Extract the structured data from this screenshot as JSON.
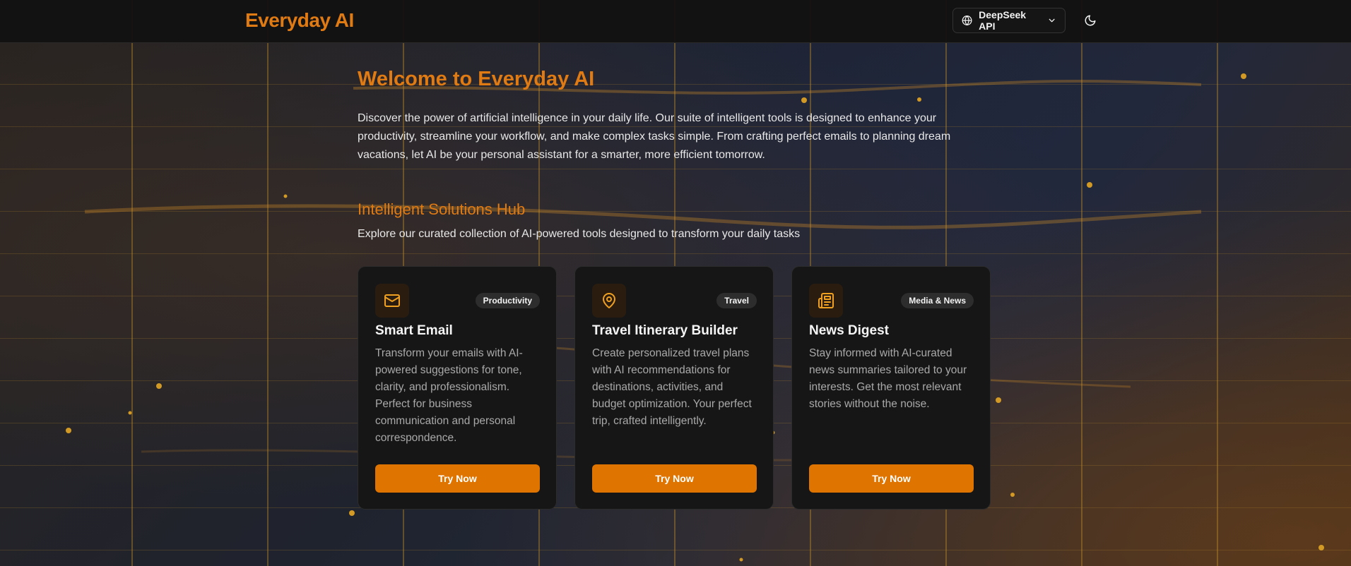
{
  "header": {
    "brand": "Everyday AI",
    "api_select": {
      "selected": "DeepSeek API",
      "icon": "globe-icon"
    },
    "theme_toggle_icon": "moon-icon"
  },
  "welcome": {
    "title": "Welcome to Everyday AI",
    "text": "Discover the power of artificial intelligence in your daily life. Our suite of intelligent tools is designed to enhance your productivity, streamline your workflow, and make complex tasks simple. From crafting perfect emails to planning dream vacations, let AI be your personal assistant for a smarter, more efficient tomorrow."
  },
  "hub": {
    "title": "Intelligent Solutions Hub",
    "subtitle": "Explore our curated collection of AI-powered tools designed to transform your daily tasks"
  },
  "cards": [
    {
      "icon": "mail-icon",
      "badge": "Productivity",
      "title": "Smart Email",
      "description": "Transform your emails with AI-powered suggestions for tone, clarity, and professionalism. Perfect for business communication and personal correspondence.",
      "button": "Try Now"
    },
    {
      "icon": "map-pin-icon",
      "badge": "Travel",
      "title": "Travel Itinerary Builder",
      "description": "Create personalized travel plans with AI recommendations for destinations, activities, and budget optimization. Your perfect trip, crafted intelligently.",
      "button": "Try Now"
    },
    {
      "icon": "newspaper-icon",
      "badge": "Media & News",
      "title": "News Digest",
      "description": "Stay informed with AI-curated news summaries tailored to your interests. Get the most relevant stories without the noise.",
      "button": "Try Now"
    }
  ],
  "colors": {
    "accent": "#e07a12",
    "button": "#e07400",
    "card_bg": "#161616",
    "header_bg": "#121212"
  }
}
